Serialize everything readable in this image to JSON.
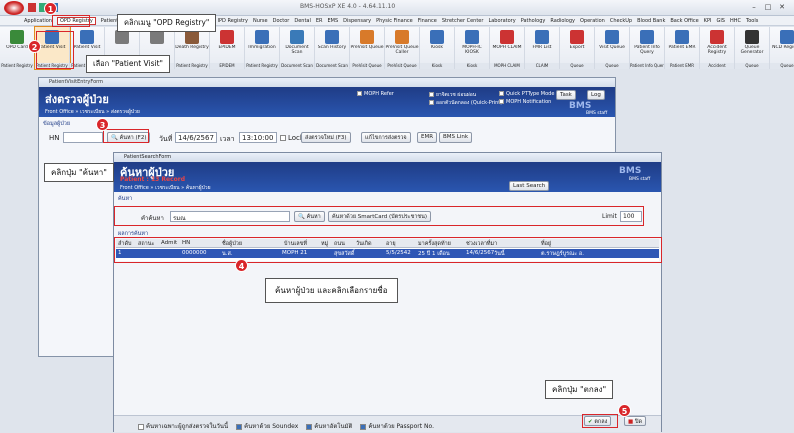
{
  "app": {
    "title": "BMS-HOSxP XE 4.0 - 4.64.11.10"
  },
  "menu": [
    "Application",
    "OPD Registry",
    "Patient",
    "Dental",
    "Pharmacy",
    "Physic Registry",
    "IPD Registry",
    "Nurse",
    "Doctor",
    "Dental",
    "ER",
    "EMS",
    "Dispensary",
    "Physic Finance",
    "Finance",
    "Stretcher Center",
    "Laboratory",
    "Pathology",
    "Radiology",
    "Operation",
    "CheckUp",
    "Blood Bank",
    "Back Office",
    "KPI",
    "GIS",
    "HHC",
    "Tools"
  ],
  "ribbon": [
    {
      "label": "OPD Card",
      "group": "Patient Registry"
    },
    {
      "label": "Patient Visit",
      "group": "Patient Registry"
    },
    {
      "label": "Patient Visit",
      "group": "Patient Registry"
    },
    {
      "label": "",
      "group": ""
    },
    {
      "label": "",
      "group": ""
    },
    {
      "label": "Death Registry",
      "group": "Patient Registry"
    },
    {
      "label": "EPIDEM",
      "group": "EPIDEM"
    },
    {
      "label": "Immigration",
      "group": "Patient Registry"
    },
    {
      "label": "Document Scan",
      "group": "Document Scan"
    },
    {
      "label": "Scan History",
      "group": "Document Scan"
    },
    {
      "label": "PreVisit Queue",
      "group": "PreVisit Queue"
    },
    {
      "label": "PreVisit Queue Caller",
      "group": "PreVisit Queue"
    },
    {
      "label": "Kiosk",
      "group": "Kiosk"
    },
    {
      "label": "MOPH-IC KIOSK",
      "group": "Kiosk"
    },
    {
      "label": "MOPH CLAIM",
      "group": "MOPH CLAIM"
    },
    {
      "label": "FMR List",
      "group": "CLAIM"
    },
    {
      "label": "Export",
      "group": "Queue"
    },
    {
      "label": "Visit Queue",
      "group": "Queue"
    },
    {
      "label": "Patient Info Query",
      "group": "Patient Info Query"
    },
    {
      "label": "Patient EMR",
      "group": "Patient EMR"
    },
    {
      "label": "Accident Registry",
      "group": "Accident"
    },
    {
      "label": "Queue Generator",
      "group": "Queue"
    },
    {
      "label": "NCD Registry",
      "group": "Queue"
    }
  ],
  "callouts": {
    "step1": "คลิกเมนู \"OPD Registry\"",
    "step2": "เลือก \"Patient Visit\"",
    "step3": "คลิกปุ่ม \"ค้นหา\"",
    "step4": "ค้นหาผู้ป่วย และคลิกเลือกรายชื่อ",
    "step5": "คลิกปุ่ม \"ตกลง\""
  },
  "badges": [
    "1",
    "2",
    "3",
    "4",
    "5"
  ],
  "visit": {
    "window_title": "PatientVisitEntryForm",
    "heading": "ส่งตรวจผู้ป่วย",
    "crumb": "Front Office » เวชระเบียน » ส่งตรวจผู้ป่วย",
    "section": "ข้อมูลผู้ป่วย",
    "hn_label": "HN",
    "search_btn": "ค้นหา (F2)",
    "date_label": "วันที่",
    "date": "14/6/2567",
    "time_label": "เวลา",
    "time": "13:10:00",
    "lock_label": "Lock",
    "send_btn": "ส่งตรวจใหม่ (F3)",
    "edit_btn": "แก้ไขการส่งตรวจ",
    "emr_btn": "EMR",
    "bms_link": "BMS Link",
    "options": [
      "MOPH Refer",
      "ยาจิตเวช ผ่อนผ่อน",
      "ออกตัวนัดกลอง (Quick-Print)",
      "Quick PTType Mode",
      "MOPH Notification"
    ],
    "task_btn": "Task",
    "log_btn": "Log",
    "bms_text": "BMS",
    "bms_staff": "BMS staff"
  },
  "search": {
    "window_title": "PatientSearchForm",
    "heading": "ค้นหาผู้ป่วย",
    "records": "Patient : 13 Record",
    "crumb": "Front Office » เวชระเบียน » ค้นหาผู้ป่วย",
    "section": "ค้นหา",
    "term_label": "คำค้นหา",
    "term_value": "รมณ",
    "search_btn": "ค้นหา",
    "smartcard_btn": "ค้นหาด้วย SmartCard (บัตรประชาชน)",
    "limit_label": "Limit",
    "limit_value": "100",
    "last_search": "Last Search",
    "result_label": "ผลการค้นหา",
    "bms_text": "BMS",
    "bms_staff": "BMS staff",
    "columns": [
      "ลำดับ",
      "สถานะ",
      "Admit",
      "HN",
      "ชื่อผู้ป่วย",
      "บ้านเลขที่",
      "หมู่",
      "ถนน",
      "วันเกิด",
      "อายุ",
      "มาครั้งสุดท้าย",
      "ช่วงเวลาที่มา",
      "ที่อยู่"
    ],
    "row": [
      "1",
      "",
      "",
      "0000000",
      "น.ส.",
      "MOPH 21",
      "",
      "",
      "สุขสวัสดิ์",
      "5/5/2542",
      "25 ปี 1 เดือน",
      "14/6/2567",
      "วันนี้",
      "ต.ราษฎร์บูรณะ อ."
    ],
    "footer_checks": [
      "ค้นหาเฉพาะผู้ถูกส่งตรวจในวันนี้",
      "ค้นหาด้วย Soundex",
      "ค้นหาอัตโนมัติ",
      "ค้นหาด้วย Passport No."
    ],
    "ok_btn": "ตกลง",
    "close_btn": "ปิด"
  },
  "colors": {
    "header": "#1f3c86",
    "accent": "#d9262a",
    "selected_row": "#2f57b5"
  }
}
